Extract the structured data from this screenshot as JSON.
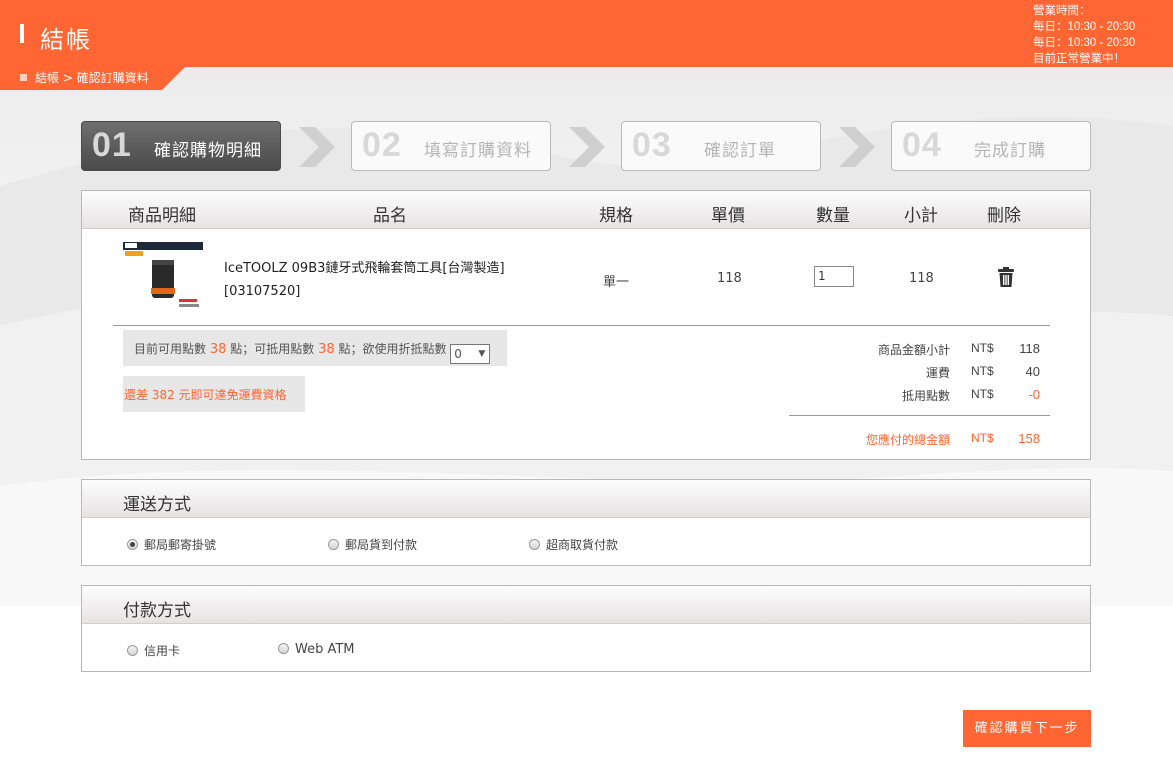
{
  "header": {
    "title": "結帳",
    "hours_line1": "營業時間：",
    "hours_line2": "每日：10:30 - 20:30",
    "hours_line3": "每日：10:30 - 20:30",
    "hours_line4": "目前正常營業中！"
  },
  "breadcrumb": {
    "text": "結帳 > 確認訂購資料"
  },
  "steps": [
    {
      "num": "01",
      "label": "確認購物明細",
      "active": true
    },
    {
      "num": "02",
      "label": "填寫訂購資料",
      "active": false
    },
    {
      "num": "03",
      "label": "確認訂單",
      "active": false
    },
    {
      "num": "04",
      "label": "完成訂購",
      "active": false
    }
  ],
  "cart": {
    "headers": {
      "detail": "商品明細",
      "name": "品名",
      "spec": "規格",
      "price": "單價",
      "qty": "數量",
      "subtotal": "小計",
      "delete": "刪除"
    },
    "items": [
      {
        "name_line1": "IceTOOLZ 09B3鏈牙式飛輪套筒工具[台灣製造]",
        "name_line2": "[03107520]",
        "spec": "單一",
        "price": "118",
        "qty": "1",
        "subtotal": "118"
      }
    ],
    "points": {
      "prefix": "目前可用點數",
      "available": "38",
      "mid1": "點；可抵用點數",
      "usable": "38",
      "mid2": "點；欲使用折抵點數",
      "selected": "0"
    },
    "free_shipping_note": "還差 382 元即可達免運費資格",
    "summary": {
      "subtotal_label": "商品金額小計",
      "subtotal_cur": "NT$",
      "subtotal_val": "118",
      "shipping_label": "運費",
      "shipping_cur": "NT$",
      "shipping_val": "40",
      "points_label": "抵用點數",
      "points_cur": "NT$",
      "points_val": "-0",
      "total_label": "您應付的總金額",
      "total_cur": "NT$",
      "total_val": "158"
    }
  },
  "shipping": {
    "title": "運送方式",
    "options": [
      "郵局郵寄掛號",
      "郵局貨到付款",
      "超商取貨付款"
    ],
    "selected_index": 0
  },
  "payment": {
    "title": "付款方式",
    "options": [
      "信用卡",
      "Web ATM"
    ]
  },
  "next_button": "確認購買下一步",
  "colors": {
    "accent": "#ff6633",
    "step_active": "#555555"
  }
}
